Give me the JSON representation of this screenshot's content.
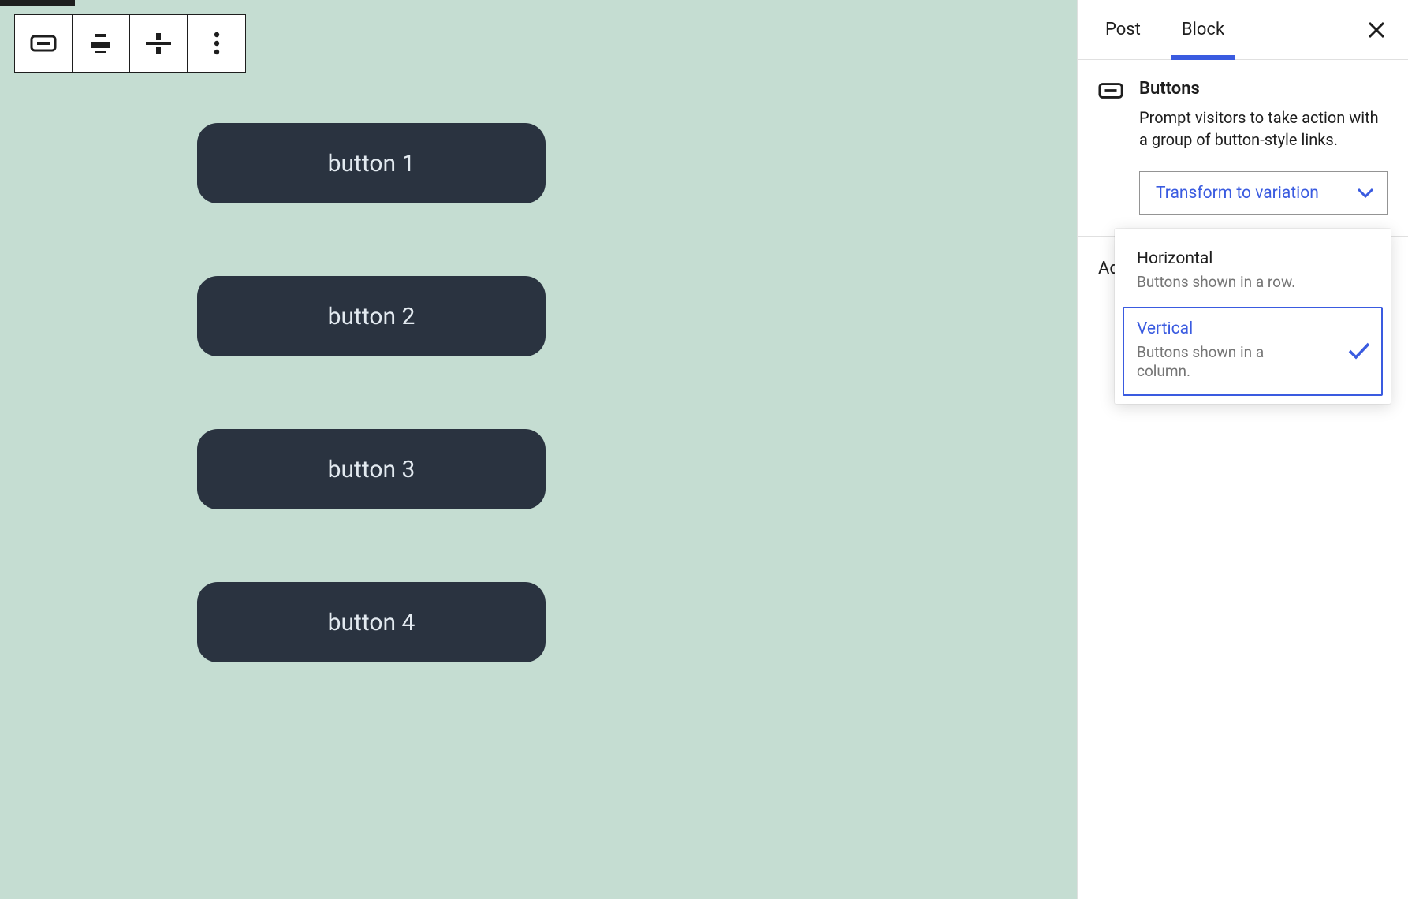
{
  "canvas": {
    "buttons": [
      "button 1",
      "button 2",
      "button 3",
      "button 4"
    ]
  },
  "toolbar": {
    "items": [
      "buttons-block-icon",
      "justify-icon",
      "align-icon",
      "more-options-icon"
    ]
  },
  "sidebar": {
    "tabs": {
      "post": "Post",
      "block": "Block",
      "active": "block"
    },
    "block": {
      "title": "Buttons",
      "description": "Prompt visitors to take action with a group of button-style links.",
      "transform_label": "Transform to variation"
    },
    "advanced_label": "Advanced",
    "variations": {
      "horizontal": {
        "title": "Horizontal",
        "desc": "Buttons shown in a row."
      },
      "vertical": {
        "title": "Vertical",
        "desc": "Buttons shown in a column."
      },
      "selected": "vertical"
    }
  },
  "colors": {
    "accent": "#3a5be0",
    "canvas_bg": "#c5ddd2",
    "button_bg": "#2a3340"
  }
}
